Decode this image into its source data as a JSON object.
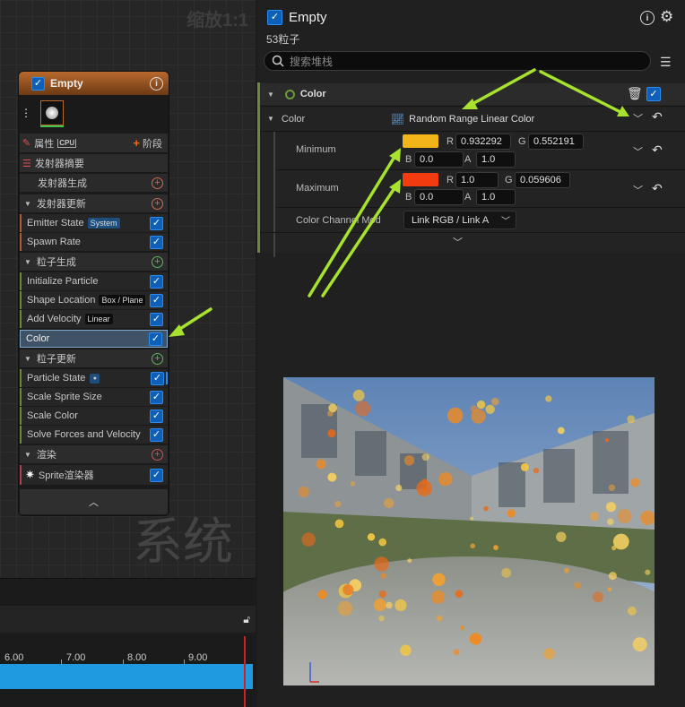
{
  "graph": {
    "zoom_label": "缩放1:1",
    "watermark": "系统"
  },
  "node": {
    "title": "Empty",
    "props_label": "属性",
    "cpu_label": "CPU",
    "stage_label": "阶段",
    "summary": "发射器摘要",
    "emitter_spawn": "发射器生成",
    "emitter_update": "发射器更新",
    "emitter_update_items": [
      {
        "label": "Emitter State",
        "tag": "System"
      },
      {
        "label": "Spawn Rate",
        "tag": ""
      }
    ],
    "particle_spawn": "粒子生成",
    "particle_spawn_items": [
      {
        "label": "Initialize Particle",
        "tag": ""
      },
      {
        "label": "Shape Location",
        "tag": "Box / Plane"
      },
      {
        "label": "Add Velocity",
        "tag": "Linear"
      },
      {
        "label": "Color",
        "tag": ""
      }
    ],
    "particle_update": "粒子更新",
    "particle_update_items": [
      {
        "label": "Particle State",
        "tag": ""
      },
      {
        "label": "Scale Sprite Size",
        "tag": ""
      },
      {
        "label": "Scale Color",
        "tag": ""
      },
      {
        "label": "Solve Forces and Velocity",
        "tag": ""
      }
    ],
    "render": "渲染",
    "renderer": "Sprite渲染器"
  },
  "timeline": {
    "ticks": [
      "6.00",
      "7.00",
      "8.00",
      "9.00"
    ]
  },
  "panel": {
    "title": "Empty",
    "subtitle": "53粒子",
    "search_placeholder": "搜索堆栈",
    "section": "Color",
    "color_label": "Color",
    "color_mode": "Random Range Linear Color",
    "min_label": "Minimum",
    "min": {
      "r": "0.932292",
      "g": "0.552191",
      "b": "0.0",
      "a": "1.0",
      "swatch": "#f2b418"
    },
    "max_label": "Maximum",
    "max": {
      "r": "1.0",
      "g": "0.059606",
      "b": "0.0",
      "a": "1.0",
      "swatch": "#f23c10"
    },
    "channel_label": "Color Channel Mod",
    "channel_value": "Link RGB / Link A",
    "r": "R",
    "g": "G",
    "b": "B",
    "a": "A"
  },
  "colors": {
    "accent": "#0e5fb8",
    "arrow": "#a6e22e"
  }
}
